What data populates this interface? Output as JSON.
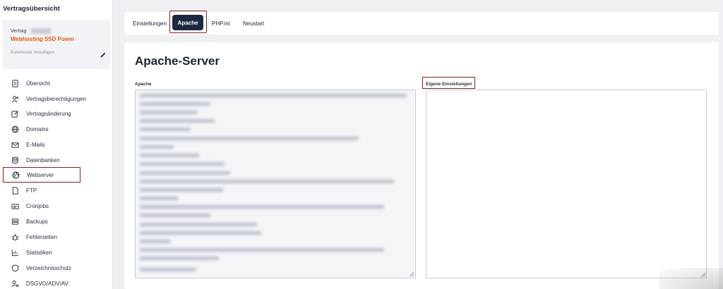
{
  "sidebar": {
    "title": "Vertragsübersicht",
    "contract": {
      "label": "Vertrag",
      "name": "Webhosting SSD Power",
      "comment_placeholder": "Kommentar hinzufügen"
    },
    "items": [
      {
        "label": "Übersicht",
        "icon": "document-icon"
      },
      {
        "label": "Vertragsberechtigungen",
        "icon": "user-plus-icon"
      },
      {
        "label": "Vertragsänderung",
        "icon": "edit-box-icon"
      },
      {
        "label": "Domains",
        "icon": "globe-icon"
      },
      {
        "label": "E-Mails",
        "icon": "mail-icon"
      },
      {
        "label": "Datenbanken",
        "icon": "database-icon"
      },
      {
        "label": "Webserver",
        "icon": "web-globe-icon",
        "active": true
      },
      {
        "label": "FTP",
        "icon": "file-icon"
      },
      {
        "label": "Cronjobs",
        "icon": "cron-icon"
      },
      {
        "label": "Backups",
        "icon": "server-stack-icon"
      },
      {
        "label": "Fehlerseiten",
        "icon": "bug-icon"
      },
      {
        "label": "Statistiken",
        "icon": "bar-chart-icon"
      },
      {
        "label": "Verzeichnisschutz",
        "icon": "shield-icon"
      },
      {
        "label": "DSGVO/ADV/AV",
        "icon": "user-key-icon"
      }
    ]
  },
  "tabs": [
    {
      "label": "Einstellungen"
    },
    {
      "label": "Apache",
      "active": true
    },
    {
      "label": "PHP.ini"
    },
    {
      "label": "Neustart"
    }
  ],
  "main": {
    "title": "Apache-Server",
    "apache_label": "Apache",
    "custom_label": "Eigene Einstellungen",
    "custom_value": ""
  },
  "colors": {
    "accent": "#e8580c",
    "active_tab_bg": "#1d2940",
    "highlight_border": "#8b1c1c"
  }
}
